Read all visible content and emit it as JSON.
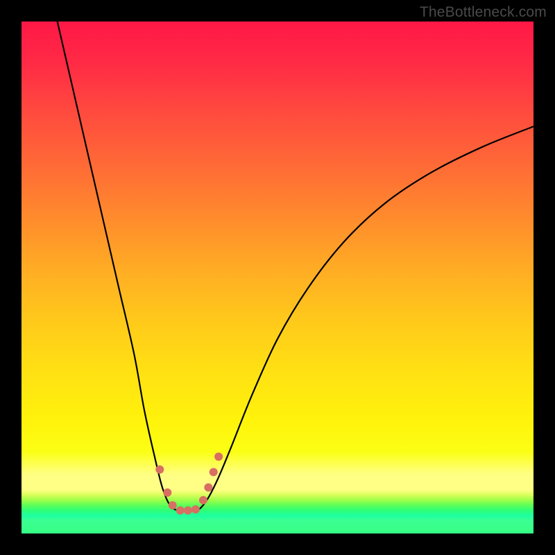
{
  "watermark": "TheBottleneck.com",
  "chart_data": {
    "type": "line",
    "title": "",
    "xlabel": "",
    "ylabel": "",
    "xlim": [
      0,
      100
    ],
    "ylim": [
      0,
      100
    ],
    "grid": false,
    "curve_left": {
      "x": [
        7,
        10,
        13,
        16,
        19,
        22,
        24,
        26,
        27.5,
        29,
        30.5,
        31.5
      ],
      "y": [
        100,
        87,
        74,
        61,
        48,
        35,
        24,
        15,
        9,
        5.5,
        4.5,
        4.5
      ]
    },
    "curve_right": {
      "x": [
        34,
        35,
        36.5,
        38.5,
        41,
        45,
        50,
        56,
        63,
        71,
        80,
        90,
        100
      ],
      "y": [
        4.5,
        5,
        7,
        11,
        17,
        27,
        38,
        48,
        57,
        64.5,
        70.5,
        75.5,
        79.5
      ]
    },
    "dots": {
      "color": "#d86f63",
      "radius_px": 6,
      "points": [
        {
          "x": 27.0,
          "y": 12.5
        },
        {
          "x": 28.5,
          "y": 8.0
        },
        {
          "x": 29.5,
          "y": 5.5
        },
        {
          "x": 31.0,
          "y": 4.5
        },
        {
          "x": 32.5,
          "y": 4.5
        },
        {
          "x": 34.0,
          "y": 4.7
        },
        {
          "x": 35.5,
          "y": 6.5
        },
        {
          "x": 36.5,
          "y": 9.0
        },
        {
          "x": 37.5,
          "y": 12.0
        },
        {
          "x": 38.5,
          "y": 15.0
        }
      ]
    },
    "gradient_stops": [
      {
        "pos": 0.0,
        "color": "#ff1846"
      },
      {
        "pos": 0.38,
        "color": "#ff8a2d"
      },
      {
        "pos": 0.78,
        "color": "#fff30b"
      },
      {
        "pos": 0.9,
        "color": "#ffff85"
      },
      {
        "pos": 0.95,
        "color": "#2eff76"
      },
      {
        "pos": 1.0,
        "color": "#35ff85"
      }
    ]
  }
}
